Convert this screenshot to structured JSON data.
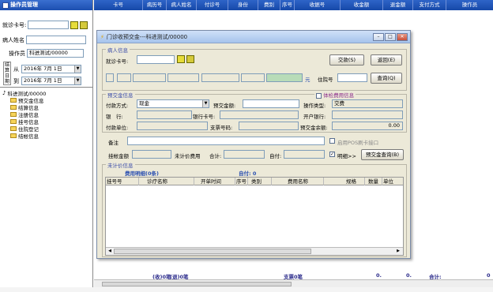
{
  "left_panel": {
    "title": "操作员管理",
    "card_label": "就诊卡号:",
    "card_btn1": "",
    "card_btn2": "",
    "name_label": "病人姓名",
    "operator_label": "操作员",
    "operator_value": "科进测试/00000",
    "date_group": "结算日期",
    "from_label": "从",
    "from_value": "2016年 7月 1日",
    "to_label": "到",
    "to_value": "2016年 7月 1日",
    "tree": {
      "root": "科进测试/00000",
      "children": [
        "预交金信息",
        "结算信息",
        "注册信息",
        "挂号信息",
        "住院登记",
        "结帐信息"
      ]
    }
  },
  "main_header": {
    "columns": [
      "卡号",
      "病历号",
      "病人姓名",
      "付诊号",
      "身份",
      "费别",
      "序号",
      "收据号",
      "收金额",
      "退金额",
      "支付方式",
      "操作员"
    ]
  },
  "totals": {
    "cash_label": "(收)0笔",
    "refund_label": "(退)0笔",
    "cheque_label": "支票0笔",
    "zero1": "0.",
    "zero2": "0.",
    "sum_label": "合计:",
    "sum_value": "0"
  },
  "dialog": {
    "title": "门诊收预交金---科进测试/00000",
    "patient_group": "病人信息",
    "card_label": "就诊卡号:",
    "pay_btn": "交款(S)",
    "return_btn": "返回(E)",
    "unit": "元",
    "receipt_label": "住院号",
    "query_btn": "查询(Q)",
    "prepay_group": "预交金信息",
    "exam_checkbox_label": "体检费用信息",
    "pay_method_label": "付款方式:",
    "pay_method_value": "现金",
    "prepay_amount_label": "预交金额:",
    "op_type_label": "操作类型:",
    "op_type_value": "交费",
    "bank_label": "银　行:",
    "bank_card_label": "银行卡号:",
    "account_bank_label": "开户银行:",
    "pay_unit_label": "付款单位:",
    "cheque_no_label": "支票号码:",
    "balance_label": "预交金余额:",
    "balance_value": "0.00",
    "remark_label": "备注",
    "pos_label": "启用POS刷卡接口",
    "paid_amount_label": "挂帐金额",
    "unsettled_label": "未计价费用",
    "total_label": "合计:",
    "self_pay_label": "自付:",
    "detail_label": "明细>>",
    "prepay_query_btn": "预交金查询(B)",
    "unpriced_group": "未计价信息",
    "fee_detail_label": "费用明细(0条)",
    "self_pay_sum_label": "自付: 0",
    "table_columns": [
      "挂号号",
      "诊疗名称",
      "开单时间",
      "序号",
      "类别",
      "费用名称",
      "规格",
      "数量",
      "单位"
    ]
  },
  "colors": {
    "header_blue": "#1f56b8",
    "dialog_bg": "#ece9d8",
    "group_title": "#3a4ca8"
  }
}
